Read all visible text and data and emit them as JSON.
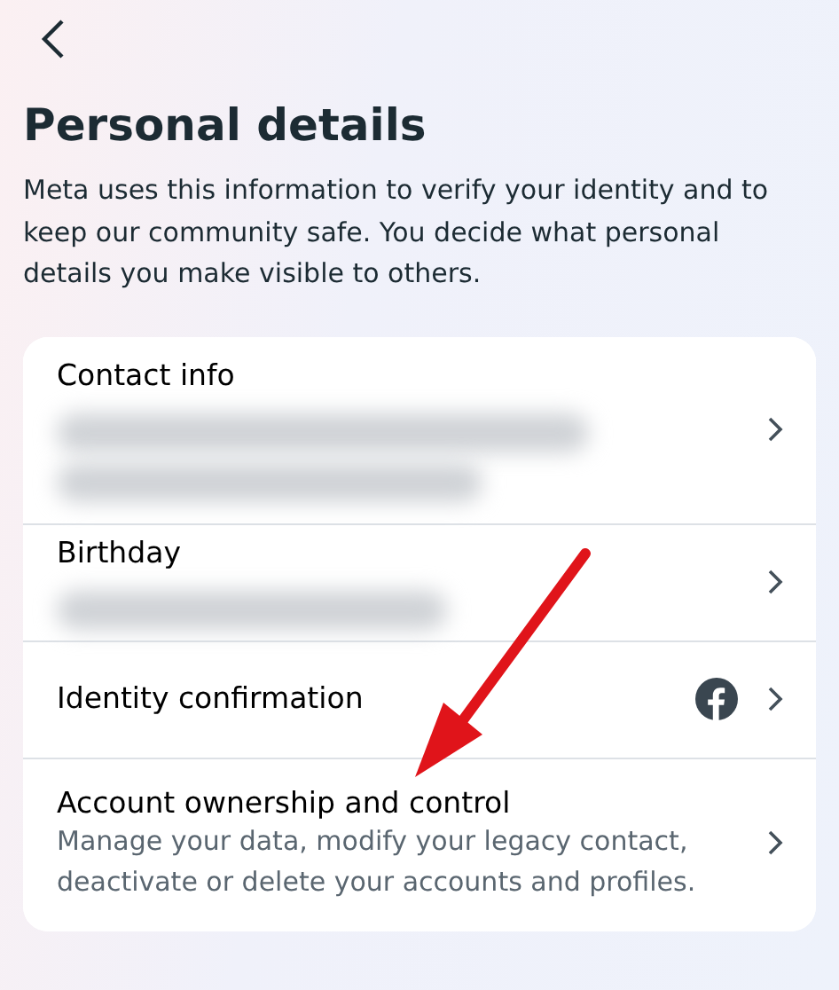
{
  "title": "Personal details",
  "description": "Meta uses this information to verify your identity and to keep our community safe. You decide what personal details you make visible to others.",
  "items": [
    {
      "kind": "redacted",
      "label": "Contact info"
    },
    {
      "kind": "redacted",
      "label": "Birthday"
    },
    {
      "kind": "logo",
      "label": "Identity confirmation"
    },
    {
      "kind": "described",
      "label": "Account ownership and control",
      "description": "Manage your data, modify your legacy contact, deactivate or delete your accounts and profiles."
    }
  ],
  "annotation": {
    "kind": "arrow"
  }
}
